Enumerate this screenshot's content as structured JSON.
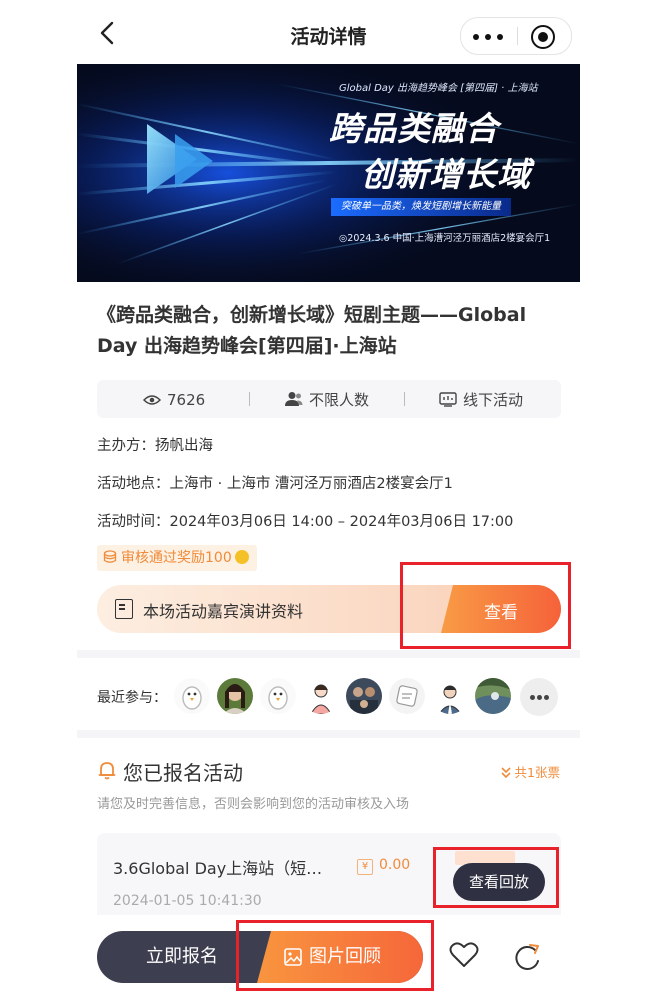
{
  "nav": {
    "title": "活动详情"
  },
  "banner": {
    "subtitle": "Global Day 出海趋势峰会 [第四届] · 上海站",
    "title_line1": "跨品类融合",
    "title_line2": "创新增长域",
    "tagline": "突破单一品类，焕发短剧增长新能量",
    "footer": "◎2024.3.6 中国·上海漕河泾万丽酒店2楼宴会厅1"
  },
  "event": {
    "title": "《跨品类融合，创新增长域》短剧主题——Global Day 出海趋势峰会[第四届]·上海站",
    "views": "7626",
    "capacity": "不限人数",
    "type": "线下活动",
    "organizer": "主办方：扬帆出海",
    "location": "活动地点：上海市 · 上海市 漕河泾万丽酒店2楼宴会厅1",
    "time": "活动时间：2024年03月06日 14:00 – 2024年03月06日 17:00",
    "reward": "审核通过奖励100"
  },
  "materials": {
    "label": "本场活动嘉宾演讲资料",
    "button": "查看"
  },
  "recent": {
    "label": "最近参与："
  },
  "registration": {
    "title": "您已报名活动",
    "count": "共1张票",
    "hint": "请您及时完善信息，否则会影响到您的活动审核及入场",
    "ticket_name": "3.6Global Day上海站（短…",
    "price": "0.00",
    "date": "2024-01-05 10:41:30",
    "replay_button": "查看回放"
  },
  "bottom": {
    "signup": "立即报名",
    "photo_review": "图片回顾"
  },
  "colors": {
    "accent": "#f5793a",
    "dark": "#3d3e50",
    "highlight": "#e8212b"
  }
}
